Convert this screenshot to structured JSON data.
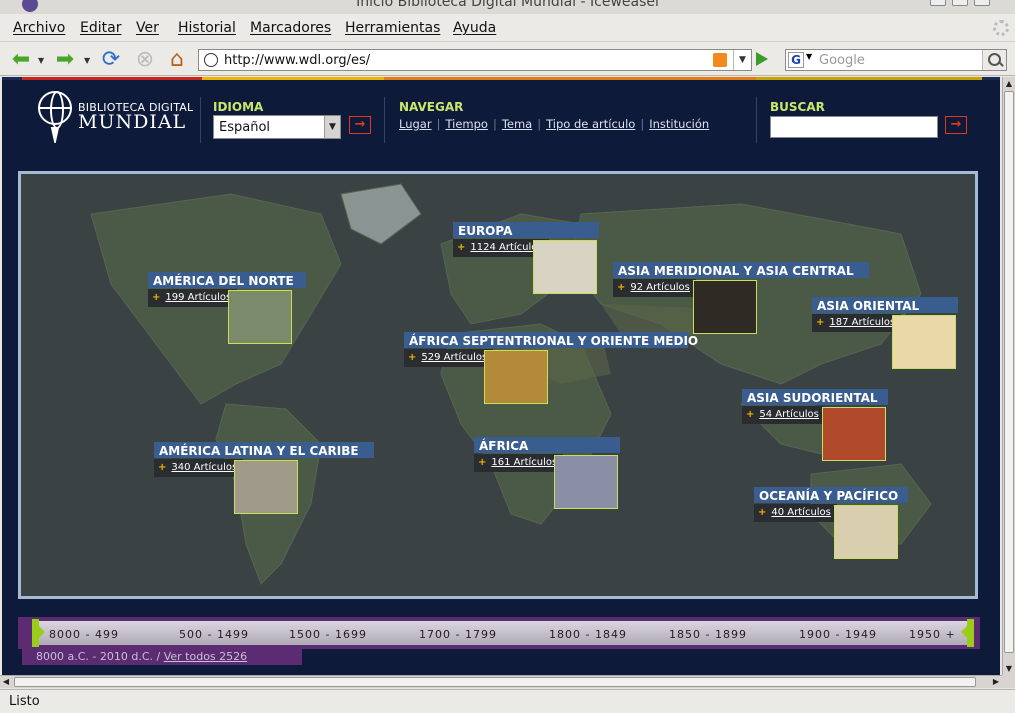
{
  "window": {
    "title": "Inicio Biblioteca Digital Mundial - Iceweasel"
  },
  "menu": [
    "Archivo",
    "Editar",
    "Ver",
    "Historial",
    "Marcadores",
    "Herramientas",
    "Ayuda"
  ],
  "nav": {
    "url": "http://www.wdl.org/es/",
    "search_placeholder": "Google",
    "search_engine": "G"
  },
  "site": {
    "logo_line1": "BIBLIOTECA DIGITAL",
    "logo_line2": "MUNDIAL",
    "idioma_label": "IDIOMA",
    "idioma_value": "Español",
    "navegar_label": "NAVEGAR",
    "navegar_links": [
      "Lugar",
      "Tiempo",
      "Tema",
      "Tipo de artículo",
      "Institución"
    ],
    "buscar_label": "BUSCAR",
    "go_symbol": "→"
  },
  "regions": [
    {
      "title": "EUROPA",
      "count": "1124 Artículos"
    },
    {
      "title": "ASIA MERIDIONAL Y ASIA CENTRAL",
      "count": "92 Artículos"
    },
    {
      "title": "AMÉRICA DEL NORTE",
      "count": "199 Artículos"
    },
    {
      "title": "ASIA ORIENTAL",
      "count": "187 Artículos"
    },
    {
      "title": "ÁFRICA SEPTENTRIONAL Y ORIENTE MEDIO",
      "count": "529 Artículos"
    },
    {
      "title": "ASIA SUDORIENTAL",
      "count": "54 Artículos"
    },
    {
      "title": "AMÉRICA LATINA Y EL CARIBE",
      "count": "340 Artículos"
    },
    {
      "title": "ÁFRICA",
      "count": "161 Artículos"
    },
    {
      "title": "OCEANÍA Y PACÍFICO",
      "count": "40 Artículos"
    }
  ],
  "timeline": {
    "periods": [
      "8000 - 499",
      "500 - 1499",
      "1500 - 1699",
      "1700 - 1799",
      "1800 - 1849",
      "1850 - 1899",
      "1900 - 1949",
      "1950 +"
    ],
    "range": "8000 a.C. - 2010 d.C. /",
    "view_all": "Ver todos 2526"
  },
  "status": "Listo",
  "colors": {
    "page_bg": "#0d1a3a",
    "accent_green": "#c9e86b",
    "region_title_bg": "#3a5d8f",
    "timeline": "#5b2c71",
    "go_red": "#e03a1a"
  }
}
